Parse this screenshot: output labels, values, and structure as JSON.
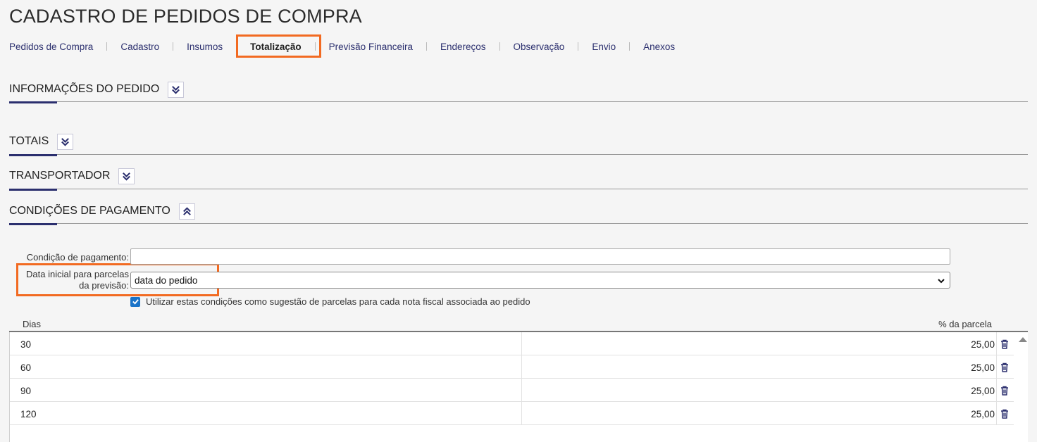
{
  "page": {
    "title": "CADASTRO DE PEDIDOS DE COMPRA"
  },
  "tabs": [
    {
      "label": "Pedidos de Compra",
      "name": "tab-pedidos-de-compra",
      "active": false
    },
    {
      "label": "Cadastro",
      "name": "tab-cadastro",
      "active": false
    },
    {
      "label": "Insumos",
      "name": "tab-insumos",
      "active": false
    },
    {
      "label": "Totalização",
      "name": "tab-totalizacao",
      "active": true
    },
    {
      "label": "Previsão Financeira",
      "name": "tab-previsao-financeira",
      "active": false
    },
    {
      "label": "Endereços",
      "name": "tab-enderecos",
      "active": false
    },
    {
      "label": "Observação",
      "name": "tab-observacao",
      "active": false
    },
    {
      "label": "Envio",
      "name": "tab-envio",
      "active": false
    },
    {
      "label": "Anexos",
      "name": "tab-anexos",
      "active": false
    }
  ],
  "sections": {
    "informacoes": {
      "title": "INFORMAÇÕES DO PEDIDO",
      "icon": "chevron-double-down-icon"
    },
    "totais": {
      "title": "TOTAIS",
      "icon": "chevron-double-down-icon"
    },
    "transportador": {
      "title": "TRANSPORTADOR",
      "icon": "chevron-double-down-icon"
    },
    "condicoes": {
      "title": "CONDIÇÕES DE PAGAMENTO",
      "icon": "chevron-double-up-icon"
    }
  },
  "form": {
    "condicao_label": "Condição de pagamento:",
    "condicao_value": "",
    "data_inicial_label_1": "Data inicial para parcelas",
    "data_inicial_label_2": "da previsão:",
    "data_inicial_value": "data do pedido",
    "checkbox_label": "Utilizar estas condições como sugestão de parcelas para cada nota fiscal associada ao pedido",
    "checkbox_checked": true
  },
  "grid": {
    "headers": {
      "dias": "Dias",
      "percentual": "% da parcela"
    },
    "rows": [
      {
        "dias": "30",
        "percentual": "25,00"
      },
      {
        "dias": "60",
        "percentual": "25,00"
      },
      {
        "dias": "90",
        "percentual": "25,00"
      },
      {
        "dias": "120",
        "percentual": "25,00"
      }
    ]
  },
  "colors": {
    "accent": "#2b2f6e",
    "highlight": "#f26a21",
    "checkbox": "#1a73c8"
  }
}
